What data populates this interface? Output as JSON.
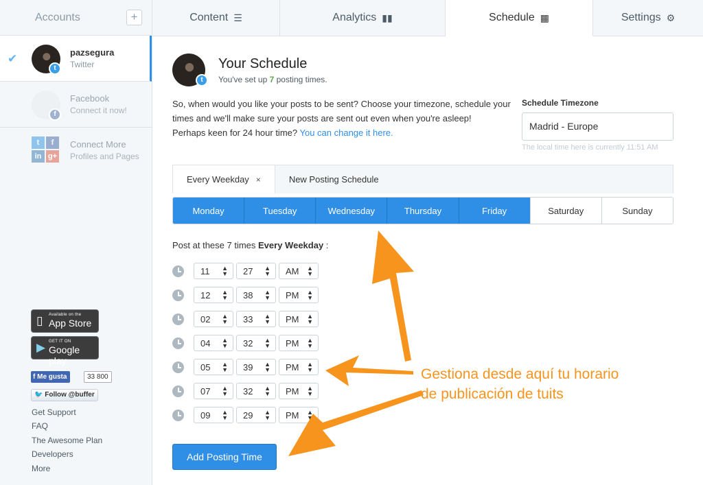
{
  "sidebar": {
    "title": "Accounts",
    "add_symbol": "+",
    "accounts": [
      {
        "name": "pazsegura",
        "sub": "Twitter"
      },
      {
        "name": "Facebook",
        "sub": "Connect it now!"
      },
      {
        "name": "Connect More",
        "sub": "Profiles and Pages"
      }
    ],
    "app_store": {
      "small": "Available on the",
      "big": "App Store"
    },
    "google_play": {
      "small": "GET IT ON",
      "big": "Google play"
    },
    "like_label": "Me gusta",
    "like_count": "33 800",
    "follow_label": "Follow @buffer",
    "links": [
      "Get Support",
      "FAQ",
      "The Awesome Plan",
      "Developers",
      "More"
    ]
  },
  "nav": {
    "tabs": [
      {
        "label": "Content",
        "icon": "layers-icon"
      },
      {
        "label": "Analytics",
        "icon": "bar-chart-icon"
      },
      {
        "label": "Schedule",
        "icon": "calendar-icon"
      },
      {
        "label": "Settings",
        "icon": "gear-icon"
      }
    ],
    "active": "Schedule"
  },
  "main": {
    "title": "Your Schedule",
    "subtitle_pre": "You've set up ",
    "subtitle_count": "7",
    "subtitle_post": " posting times.",
    "desc_text": "So, when would you like your posts to be sent? Choose your timezone, schedule your times and we'll make sure your posts are sent out even when you're asleep!",
    "desc_24h": "Perhaps keen for 24 hour time? ",
    "desc_link": "You can change it here.",
    "timezone_label": "Schedule Timezone",
    "timezone_value": "Madrid - Europe",
    "timezone_note": "The local time here is currently 11:51 AM",
    "schedule_tabs": [
      {
        "label": "Every Weekday",
        "close": "×"
      },
      {
        "label": "New Posting Schedule"
      }
    ],
    "days": [
      {
        "label": "Monday",
        "on": true
      },
      {
        "label": "Tuesday",
        "on": true
      },
      {
        "label": "Wednesday",
        "on": true
      },
      {
        "label": "Thursday",
        "on": true
      },
      {
        "label": "Friday",
        "on": true
      },
      {
        "label": "Saturday",
        "on": false
      },
      {
        "label": "Sunday",
        "on": false
      }
    ],
    "post_label_pre": "Post at these 7 times ",
    "post_label_bold": "Every Weekday",
    "post_label_post": " :",
    "times": [
      {
        "h": "11",
        "m": "27",
        "ap": "AM"
      },
      {
        "h": "12",
        "m": "38",
        "ap": "PM"
      },
      {
        "h": "02",
        "m": "33",
        "ap": "PM"
      },
      {
        "h": "04",
        "m": "32",
        "ap": "PM"
      },
      {
        "h": "05",
        "m": "39",
        "ap": "PM"
      },
      {
        "h": "07",
        "m": "32",
        "ap": "PM"
      },
      {
        "h": "09",
        "m": "29",
        "ap": "PM"
      }
    ],
    "add_button": "Add Posting Time"
  },
  "annotation": {
    "line1": "Gestiona desde aquí tu horario",
    "line2": "de publicación de tuits",
    "color": "#f7941e"
  }
}
